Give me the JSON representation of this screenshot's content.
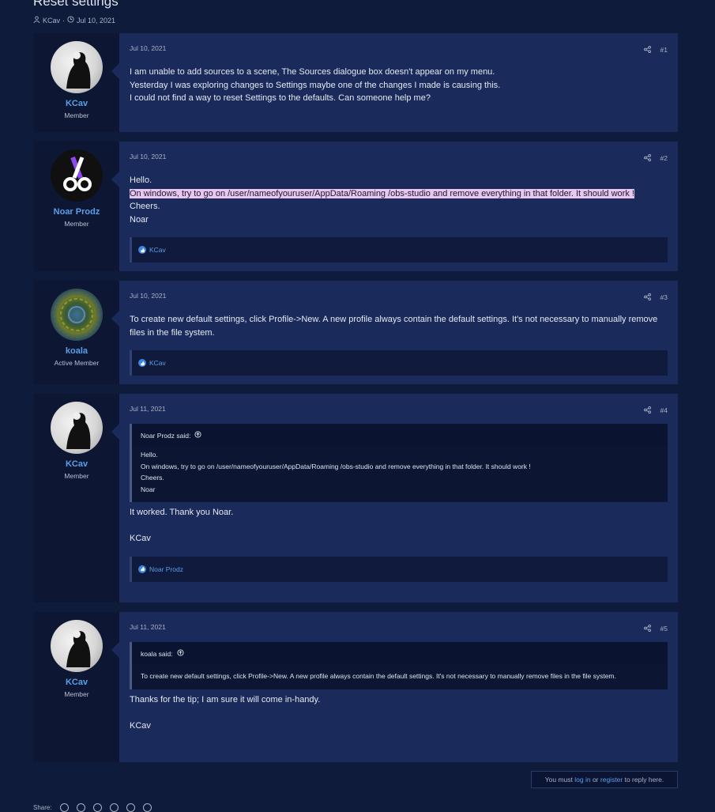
{
  "thread": {
    "title": "Reset settings",
    "author": "KCav",
    "date": "Jul 10, 2021"
  },
  "posts": [
    {
      "user": "KCav",
      "title": "Member",
      "date": "Jul 10, 2021",
      "num": "#1",
      "lines": [
        "I am unable to add sources to a scene, The Sources dialogue box doesn't appear on my menu.",
        "Yesterday I was exploring changes to Settings maybe one of the changes I made is causing this.",
        "I could not find a way to reset Settings to the defaults. Can someone help me?"
      ]
    },
    {
      "user": "Noar Prodz",
      "title": "Member",
      "date": "Jul 10, 2021",
      "num": "#2",
      "lines": [
        "Hello.",
        "On windows, try to go on /user/nameofyouruser/AppData/Roaming /obs-studio and remove everything in that folder. It should work !",
        "Cheers.",
        "Noar"
      ],
      "reaction": "KCav"
    },
    {
      "user": "koala",
      "title": "Active Member",
      "date": "Jul 10, 2021",
      "num": "#3",
      "lines": [
        "To create new default settings, click Profile->New. A new profile always contain the default settings. It's not necessary to manually remove files in the file system."
      ],
      "reaction": "KCav"
    },
    {
      "user": "KCav",
      "title": "Member",
      "date": "Jul 11, 2021",
      "num": "#4",
      "quote": {
        "head": "Noar Prodz said:",
        "lines": [
          "Hello.",
          "On windows, try to go on /user/nameofyouruser/AppData/Roaming /obs-studio and remove everything in that folder. It should work !",
          "Cheers.",
          "Noar"
        ]
      },
      "lines": [
        "It worked. Thank you Noar.",
        "",
        "KCav"
      ],
      "reaction": "Noar Prodz"
    },
    {
      "user": "KCav",
      "title": "Member",
      "date": "Jul 11, 2021",
      "num": "#5",
      "quote": {
        "head": "koala said:",
        "lines": [
          "To create new default settings, click Profile->New. A new profile always contain the default settings. It's not necessary to manually remove files in the file system."
        ]
      },
      "lines": [
        "Thanks for the tip; I am sure it will come in-handy.",
        "",
        "KCav"
      ]
    }
  ],
  "reply": {
    "prefix": "You must ",
    "login": "log in",
    "middle": " or ",
    "register": "register",
    "suffix": " to reply here."
  },
  "share": {
    "label": "Share:"
  },
  "colors": {
    "background": "#0f1b3b",
    "post": "#1a2a5a",
    "link": "#5a9fea",
    "highlight": "#e8c6f0"
  }
}
